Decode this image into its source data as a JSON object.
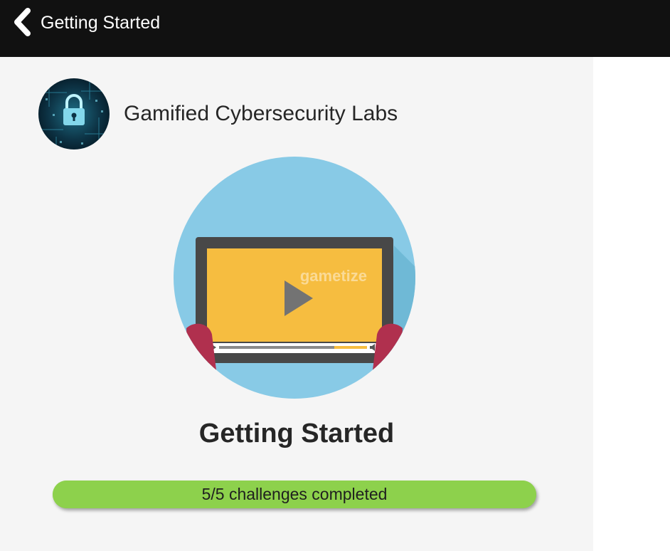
{
  "header": {
    "title": "Getting Started",
    "back_icon": "chevron-left-icon",
    "background": "#111111"
  },
  "project": {
    "name": "Gamified Cybersecurity Labs",
    "avatar_icon": "padlock-circuit-avatar"
  },
  "topic": {
    "title": "Getting Started",
    "image_icon": "video-player-illustration",
    "watermark": "gametize"
  },
  "progress": {
    "label": "5/5 challenges completed",
    "completed": 5,
    "total": 5,
    "fraction": 1.0,
    "color": "#8dd14c"
  }
}
